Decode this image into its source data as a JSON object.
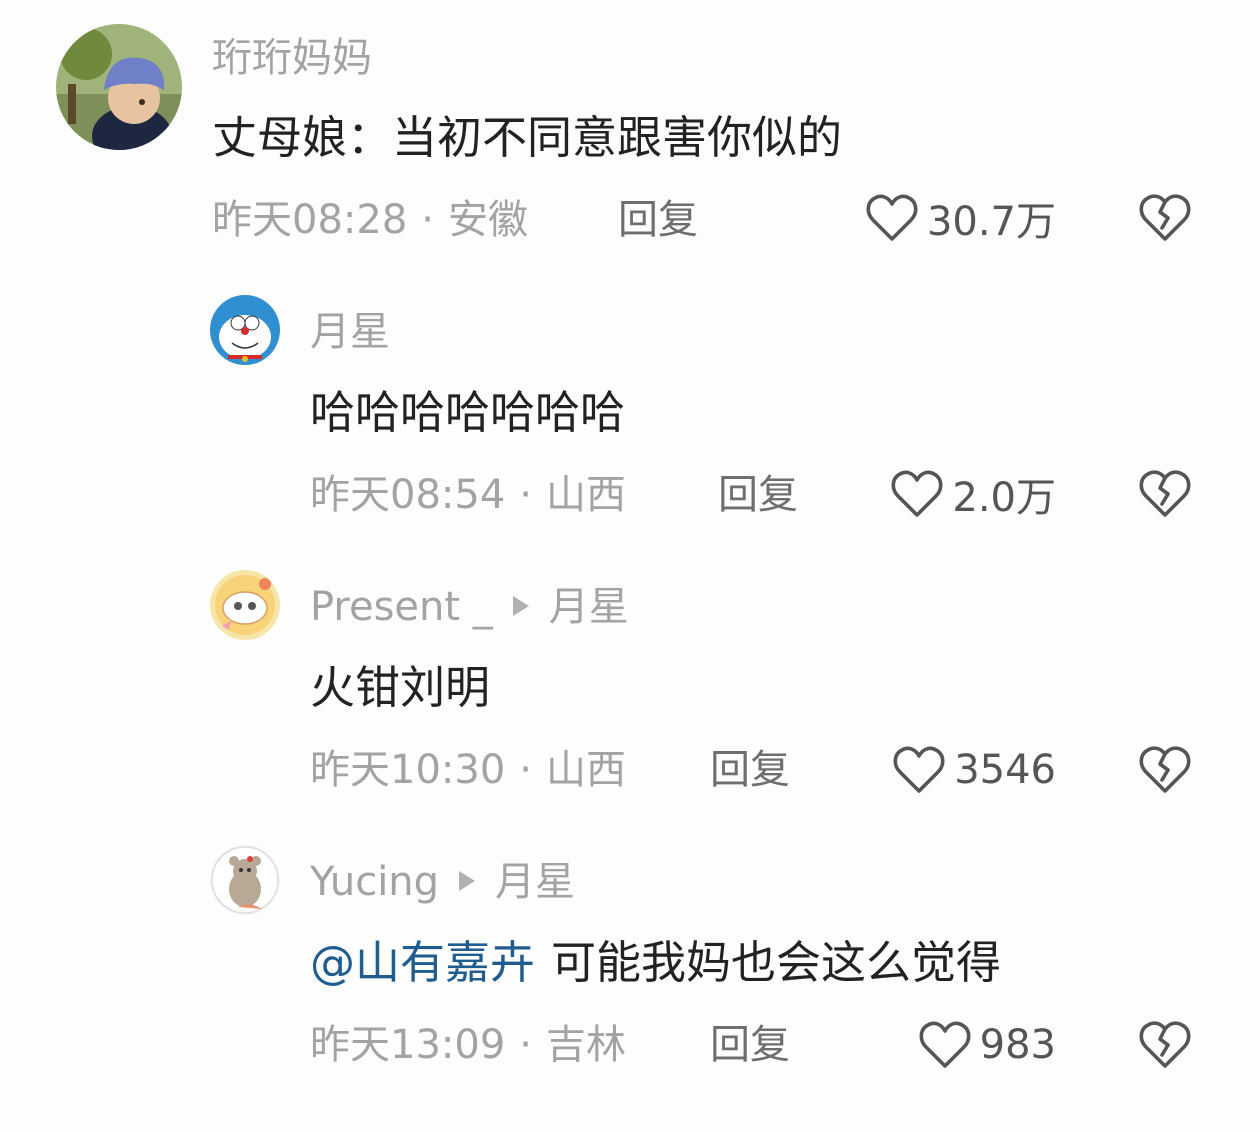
{
  "comments": [
    {
      "username": "珩珩妈妈",
      "content": "丈母娘：当初不同意跟害你似的",
      "time": "昨天08:28",
      "location": "安徽",
      "reply_label": "回复",
      "likes": "30.7万"
    },
    {
      "username": "月星",
      "content": "哈哈哈哈哈哈哈",
      "time": "昨天08:54",
      "location": "山西",
      "reply_label": "回复",
      "likes": "2.0万"
    },
    {
      "username": "Present _",
      "reply_to": "月星",
      "content": "火钳刘明",
      "time": "昨天10:30",
      "location": "山西",
      "reply_label": "回复",
      "likes": "3546"
    },
    {
      "username": "Yucing",
      "reply_to": "月星",
      "mention": "@山有嘉卉",
      "content": "可能我妈也会这么觉得",
      "time": "昨天13:09",
      "location": "吉林",
      "reply_label": "回复",
      "likes": "983"
    }
  ],
  "separator": "·",
  "icons": {
    "like": "heart-outline-icon",
    "dislike": "broken-heart-icon",
    "reply_arrow": "triangle-right-icon"
  },
  "colors": {
    "username": "#a3a3a3",
    "content": "#222222",
    "mention": "#1f5c8f",
    "reply": "#6e6e6e"
  }
}
